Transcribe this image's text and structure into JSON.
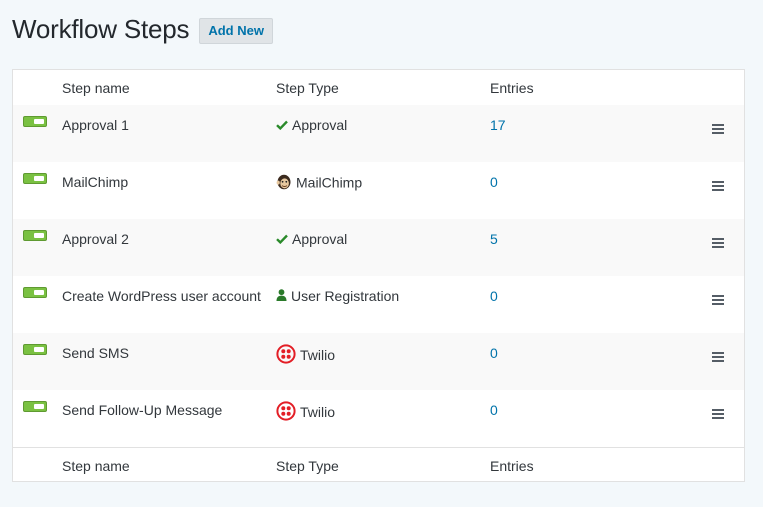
{
  "page": {
    "title": "Workflow Steps",
    "add_new_label": "Add New"
  },
  "table": {
    "columns": [
      "Step name",
      "Step Type",
      "Entries"
    ],
    "rows": [
      {
        "name": "Approval 1",
        "type": "Approval",
        "type_icon": "checkmark-icon",
        "entries": "17",
        "active": true
      },
      {
        "name": "MailChimp",
        "type": "MailChimp",
        "type_icon": "mailchimp-icon",
        "entries": "0",
        "active": true
      },
      {
        "name": "Approval 2",
        "type": "Approval",
        "type_icon": "checkmark-icon",
        "entries": "5",
        "active": true
      },
      {
        "name": "Create WordPress user account",
        "type": "User Registration",
        "type_icon": "user-icon",
        "entries": "0",
        "active": true
      },
      {
        "name": "Send SMS",
        "type": "Twilio",
        "type_icon": "twilio-icon",
        "entries": "0",
        "active": true
      },
      {
        "name": "Send Follow-Up Message",
        "type": "Twilio",
        "type_icon": "twilio-icon",
        "entries": "0",
        "active": true
      }
    ]
  },
  "colors": {
    "toggle_active": "#7ac142",
    "link": "#0073aa",
    "checkmark": "#2a8a2a",
    "twilio": "#e31e26"
  }
}
